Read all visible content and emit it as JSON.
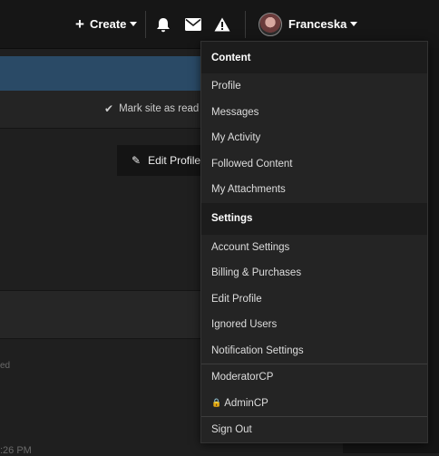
{
  "topbar": {
    "create_label": "Create",
    "icons": [
      "bell-icon",
      "envelope-icon",
      "warning-icon"
    ],
    "username": "Franceska"
  },
  "background": {
    "mark_read_label": "Mark site as read",
    "edit_profile_label": "Edit Profile",
    "faded_text_1": "ed",
    "faded_text_2": ":26 PM"
  },
  "menu": {
    "content_header": "Content",
    "content_items": [
      "Profile",
      "Messages",
      "My Activity",
      "Followed Content",
      "My Attachments"
    ],
    "settings_header": "Settings",
    "settings_items": [
      "Account Settings",
      "Billing & Purchases",
      "Edit Profile",
      "Ignored Users",
      "Notification Settings"
    ],
    "admin_items": [
      "ModeratorCP",
      "AdminCP"
    ],
    "signout_label": "Sign Out"
  },
  "colors": {
    "banner": "#2a4a66",
    "background": "#1f1f1f",
    "topbar": "#161616"
  }
}
